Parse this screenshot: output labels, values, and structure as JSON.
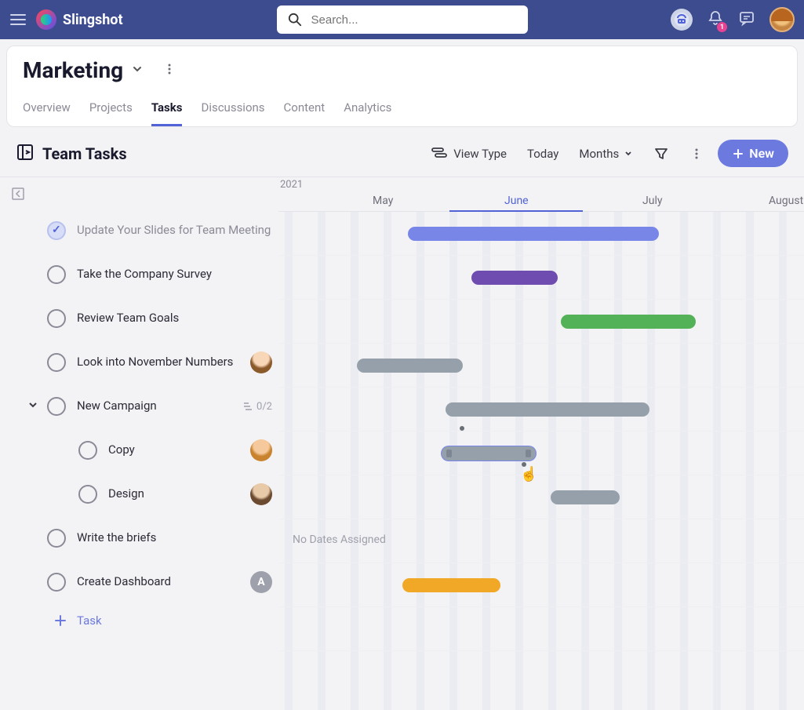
{
  "app": {
    "name": "Slingshot"
  },
  "search": {
    "placeholder": "Search..."
  },
  "notifications": {
    "count": "1"
  },
  "page": {
    "title": "Marketing"
  },
  "tabs": [
    {
      "label": "Overview"
    },
    {
      "label": "Projects"
    },
    {
      "label": "Tasks",
      "active": true
    },
    {
      "label": "Discussions"
    },
    {
      "label": "Content"
    },
    {
      "label": "Analytics"
    }
  ],
  "panel": {
    "title": "Team Tasks"
  },
  "toolbar": {
    "view_type": "View Type",
    "today": "Today",
    "scale": "Months",
    "new": "New"
  },
  "timeline": {
    "year": "2021",
    "months": [
      "May",
      "June",
      "July",
      "August"
    ],
    "current_month": "June",
    "no_dates_label": "No Dates Assigned"
  },
  "tasks": [
    {
      "label": "Update Your Slides for Team Meeting",
      "done": true
    },
    {
      "label": "Take the Company Survey"
    },
    {
      "label": "Review Team Goals"
    },
    {
      "label": "Look into November Numbers",
      "avatar": "av1"
    },
    {
      "label": "New Campaign",
      "expandable": true,
      "subtask_count": "0/2"
    },
    {
      "label": "Copy",
      "sub": true,
      "avatar": "av2"
    },
    {
      "label": "Design",
      "sub": true,
      "avatar": "av3"
    },
    {
      "label": "Write the briefs"
    },
    {
      "label": "Create Dashboard",
      "avatar": "A"
    }
  ],
  "add_task": {
    "label": "Task"
  },
  "chart_data": {
    "type": "gantt",
    "year": 2021,
    "x_axis_months": [
      "May",
      "June",
      "July",
      "August"
    ],
    "rows": [
      {
        "task": "Update Your Slides for Team Meeting",
        "color": "#7886e8",
        "start_pct": 25,
        "width_pct": 48
      },
      {
        "task": "Take the Company Survey",
        "color": "#6f4db0",
        "start_pct": 37,
        "width_pct": 17
      },
      {
        "task": "Review Team Goals",
        "color": "#53b257",
        "start_pct": 54,
        "width_pct": 26
      },
      {
        "task": "Look into November Numbers",
        "color": "#95a0aa",
        "start_pct": 15,
        "width_pct": 20
      },
      {
        "task": "New Campaign",
        "color": "#95a0aa",
        "start_pct": 32,
        "width_pct": 39
      },
      {
        "task": "Copy",
        "color": "#95a0aa",
        "start_pct": 31,
        "width_pct": 18,
        "selected": true
      },
      {
        "task": "Design",
        "color": "#95a0aa",
        "start_pct": 52,
        "width_pct": 13
      },
      {
        "task": "Write the briefs",
        "no_dates": true
      },
      {
        "task": "Create Dashboard",
        "color": "#f0a826",
        "start_pct": 24,
        "width_pct": 19
      }
    ]
  }
}
